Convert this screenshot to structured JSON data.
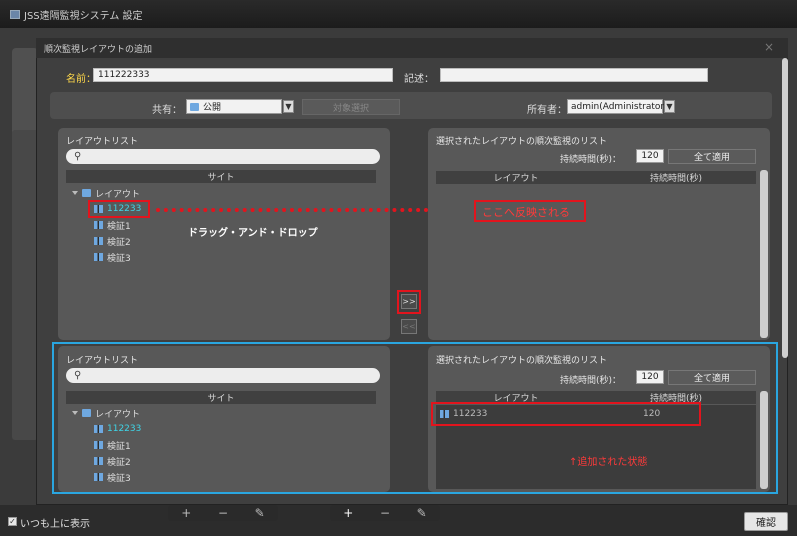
{
  "app": {
    "title": "JSS遠隔監視システム 設定"
  },
  "dialog": {
    "title": "順次監視レイアウトの追加",
    "close_glyph": "×"
  },
  "form": {
    "name_label": "名前：",
    "name_value": "111222333",
    "desc_label": "記述：",
    "desc_value": ""
  },
  "share": {
    "share_label": "共有：",
    "share_value": "公開",
    "target_select_label": "対象選択",
    "owner_label": "所有者：",
    "owner_value": "admin(Administrators)"
  },
  "top": {
    "layout_list_title": "レイアウトリスト",
    "site_col": "サイト",
    "tree_root": "レイアウト",
    "tree_items": [
      "112233",
      "検証1",
      "検証2",
      "検証3"
    ],
    "selected_title": "選択されたレイアウトの順次監視のリスト",
    "duration_label": "持続時間(秒)：",
    "duration_value": "120",
    "apply_all": "全て適用",
    "col_layout": "レイアウト",
    "col_duration": "持続時間(秒)"
  },
  "bottom": {
    "layout_list_title": "レイアウトリスト",
    "site_col": "サイト",
    "tree_root": "レイアウト",
    "tree_items": [
      "112233",
      "検証1",
      "検証2",
      "検証3"
    ],
    "selected_title": "選択されたレイアウトの順次監視のリスト",
    "duration_label": "持続時間(秒)：",
    "duration_value": "120",
    "apply_all": "全て適用",
    "col_layout": "レイアウト",
    "col_duration": "持続時間(秒)",
    "rows": [
      {
        "layout": "112233",
        "duration": "120"
      }
    ]
  },
  "annotations": {
    "drag_drop": "ドラッグ・アンド・ドロップ",
    "reflected": "ここへ反映される",
    "after_text": "↑追加された状態"
  },
  "mid_buttons": {
    "add": ">>",
    "remove": "<<"
  },
  "footer": {
    "always_on_top": "いつも上に表示",
    "confirm": "確認",
    "toolbar_glyphs": [
      "+",
      "−",
      "✎"
    ]
  },
  "colors": {
    "annotation_red": "#e2141d",
    "annotation_blue": "#2aa6e0",
    "label_yellow": "#ffd84a",
    "highlight_cyan": "#3fd4e6"
  }
}
